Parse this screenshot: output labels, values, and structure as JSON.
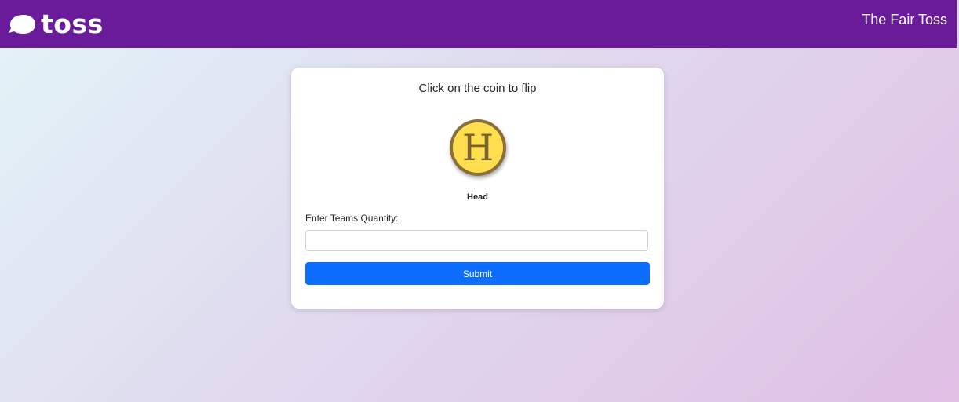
{
  "header": {
    "logo_text": "toss",
    "logo_icon": "speech-bubble-icon",
    "site_title": "The Fair Toss"
  },
  "card": {
    "instruction": "Click on the coin to flip",
    "coin": {
      "face_letter": "H",
      "result_label": "Head"
    },
    "teams_field": {
      "label": "Enter Teams Quantity:",
      "value": "",
      "placeholder": ""
    },
    "submit_label": "Submit"
  },
  "colors": {
    "navbar": "#6a1b9a",
    "button": "#0d6efd",
    "coin_face": "#ffdf4f",
    "coin_rim": "#8b6f3a"
  }
}
